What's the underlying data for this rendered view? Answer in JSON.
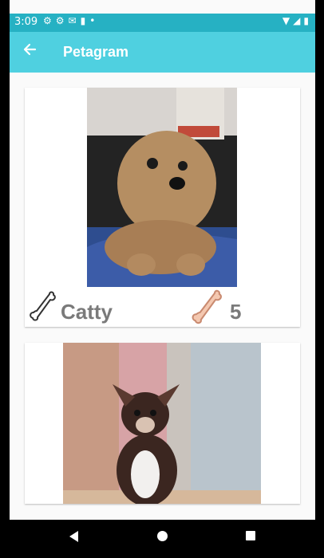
{
  "status_bar": {
    "time": "3:09",
    "icons": [
      "gear-icon",
      "gear-icon",
      "mail-icon",
      "sdcard-icon",
      "dot-icon"
    ],
    "right_icons": [
      "wifi-icon",
      "signal-icon",
      "battery-icon"
    ]
  },
  "app_bar": {
    "title": "Petagram",
    "back_icon": "arrow-back-icon",
    "color": "#4fd0e0"
  },
  "pets": [
    {
      "name": "Catty",
      "likes": "5",
      "photo": "fluffy-poodle-dog"
    },
    {
      "name": "",
      "likes": "",
      "photo": "chihuahua-dog"
    }
  ],
  "colors": {
    "status_bar": "#26b1c3",
    "bone_outline": "#333333",
    "bone_filled": "#f4c8b0",
    "text": "#7a7a7a"
  },
  "nav_bar": {
    "back": "triangle",
    "home": "circle",
    "recent": "square"
  }
}
